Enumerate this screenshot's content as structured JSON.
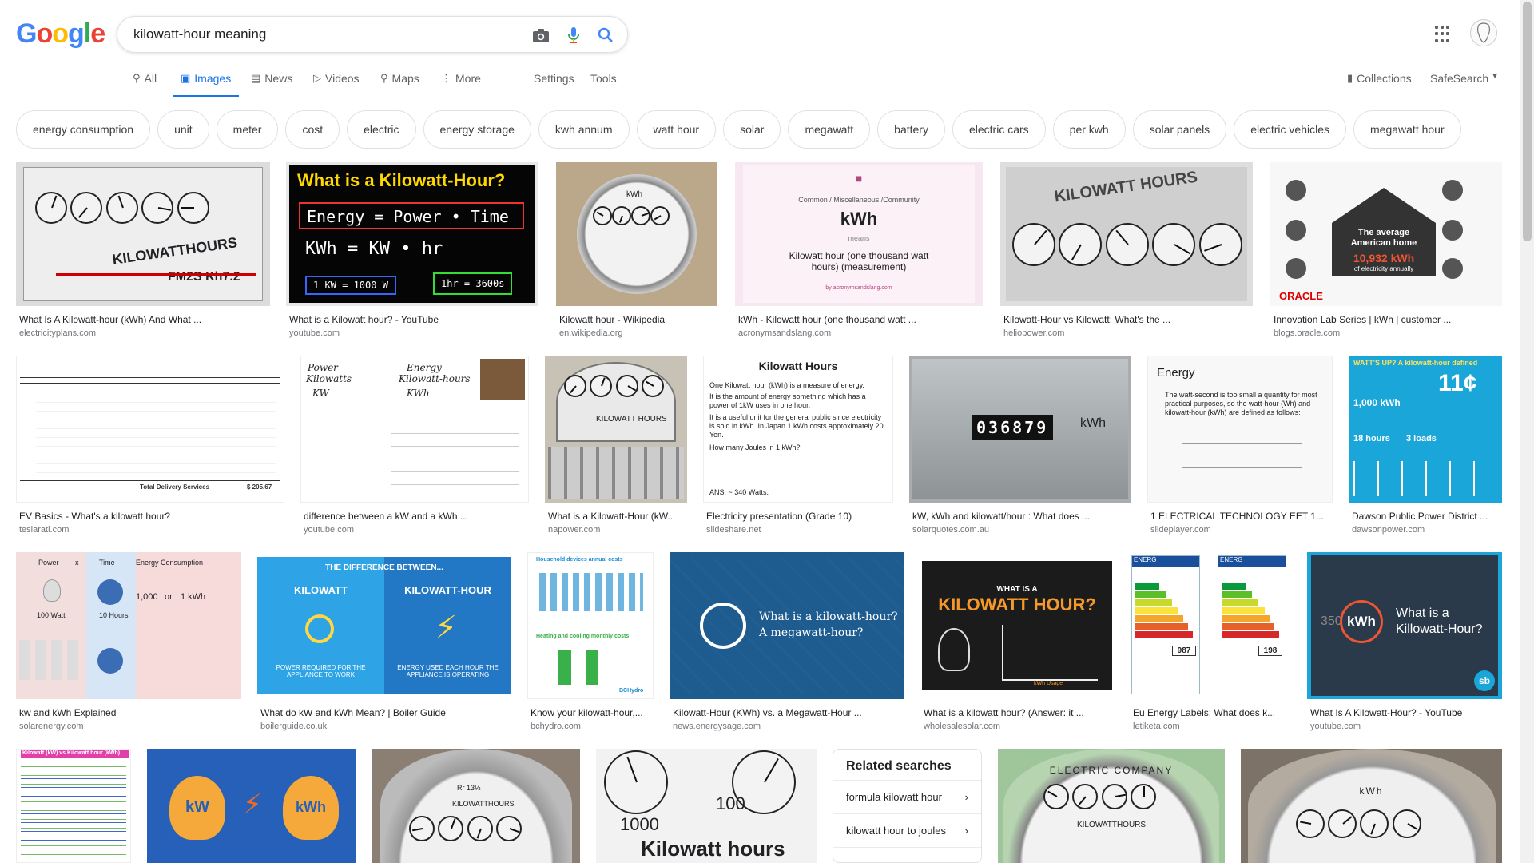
{
  "logo": {
    "letters": [
      "G",
      "o",
      "o",
      "g",
      "l",
      "e"
    ],
    "colors": [
      "#4285f4",
      "#ea4335",
      "#fbbc05",
      "#4285f4",
      "#34a853",
      "#ea4335"
    ]
  },
  "search": {
    "query": "kilowatt-hour meaning"
  },
  "icons": {
    "camera": "camera-icon",
    "mic": "mic-icon",
    "search": "search-icon",
    "apps": "apps-grid-icon"
  },
  "tabs": [
    {
      "label": "All",
      "icon": "search-icon"
    },
    {
      "label": "Images",
      "icon": "image-icon"
    },
    {
      "label": "News",
      "icon": "news-icon"
    },
    {
      "label": "Videos",
      "icon": "video-icon"
    },
    {
      "label": "Maps",
      "icon": "map-icon"
    },
    {
      "label": "More",
      "icon": "more-dots-icon"
    },
    {
      "label": "Settings"
    },
    {
      "label": "Tools"
    }
  ],
  "collections": {
    "label": "Collections"
  },
  "safesearch": {
    "label": "SafeSearch"
  },
  "chips": [
    "energy consumption",
    "unit",
    "meter",
    "cost",
    "electric",
    "energy storage",
    "kwh annum",
    "watt hour",
    "solar",
    "megawatt",
    "battery",
    "electric cars",
    "per kwh",
    "solar panels",
    "electric vehicles",
    "megawatt hour"
  ],
  "results": [
    {
      "title": "What Is A Kilowatt-hour (kWh) And What ...",
      "source": "electricityplans.com"
    },
    {
      "title": "What is a Kilowatt hour? - YouTube",
      "source": "youtube.com"
    },
    {
      "title": "Kilowatt hour - Wikipedia",
      "source": "en.wikipedia.org"
    },
    {
      "title": "kWh - Kilowatt hour (one thousand watt ...",
      "source": "acronymsandslang.com"
    },
    {
      "title": "Kilowatt-Hour vs Kilowatt: What's the ...",
      "source": "heliopower.com"
    },
    {
      "title": "Innovation Lab Series | kWh | customer ...",
      "source": "blogs.oracle.com"
    },
    {
      "title": "EV Basics - What's a kilowatt hour?",
      "source": "teslarati.com"
    },
    {
      "title": "difference between a kW and a kWh ...",
      "source": "youtube.com"
    },
    {
      "title": "What is a Kilowatt-Hour (kW...",
      "source": "napower.com"
    },
    {
      "title": "Electricity presentation (Grade 10)",
      "source": "slideshare.net"
    },
    {
      "title": "kW, kWh and kilowatt/hour : What does ...",
      "source": "solarquotes.com.au"
    },
    {
      "title": "1 ELECTRICAL TECHNOLOGY EET 1...",
      "source": "slideplayer.com"
    },
    {
      "title": "Dawson Public Power District ...",
      "source": "dawsonpower.com"
    },
    {
      "title": "kw and kWh Explained",
      "source": "solarenergy.com"
    },
    {
      "title": "What do kW and kWh Mean? | Boiler Guide",
      "source": "boilerguide.co.uk"
    },
    {
      "title": "Know your kilowatt-hour,...",
      "source": "bchydro.com"
    },
    {
      "title": "Kilowatt-Hour (KWh) vs. a Megawatt-Hour ...",
      "source": "news.energysage.com"
    },
    {
      "title": "What is a kilowatt hour? (Answer: it ...",
      "source": "wholesalesolar.com"
    },
    {
      "title": "Eu Energy Labels: What does k...",
      "source": "letiketa.com"
    },
    {
      "title": "What Is A Kilowatt-Hour? - YouTube",
      "source": "youtube.com"
    }
  ],
  "thumbs": {
    "t1": {
      "brand": "KILOWATTHOURS",
      "model": "FM2S Kh7.2"
    },
    "t2": {
      "heading": "What is a Kilowatt-Hour?",
      "l1": "Energy = Power • Time",
      "l2": "KWh = KW • hr",
      "b1": "1 KW = 1000 W",
      "b2": "1hr = 3600s"
    },
    "t3": {
      "label": "kWh"
    },
    "t4": {
      "crumb": "Common / Miscellaneous /Community",
      "big": "kWh",
      "means": "means",
      "def": "Kilowatt hour (one thousand watt hours) (measurement)",
      "site": "by acronymsandslang.com"
    },
    "t5": {
      "label": "KILOWATT HOURS"
    },
    "t6": {
      "l1": "The average",
      "l2": "American home",
      "amount": "10,932 kWh",
      "l3": "of electricity annually",
      "brand": "ORACLE"
    },
    "t7": {
      "total": "Total Delivery Services",
      "amount": "$ 205.67"
    },
    "t8": {
      "a": "Power",
      "b": "Energy",
      "c": "Kilowatts",
      "d": "Kilowatt-hours",
      "e": "KW",
      "f": "KWh"
    },
    "t9": {
      "label": "KILOWATT HOURS"
    },
    "t10": {
      "heading": "Kilowatt Hours",
      "p1": "One Kilowatt hour (kWh) is a measure of energy.",
      "p2": "It is the amount of energy something which has a power of 1kW uses in one hour.",
      "p3": "It is a useful unit for the general public since electricity is sold in kWh. In Japan 1 kWh costs approximately 20 Yen.",
      "p4": "How many Joules in 1 kWh?",
      "ans": "ANS: ~ 340 Watts."
    },
    "t11": {
      "digits": "036879",
      "unit": "kWh"
    },
    "t12": {
      "heading": "Energy",
      "body": "The watt-second is too small a quantity for most practical purposes, so the watt-hour (Wh) and kilowatt-hour (kWh) are defined as follows:"
    },
    "t13": {
      "title": "WATT'S UP? A kilowatt-hour defined",
      "price": "11¢",
      "k": "1,000 kWh",
      "h": "18 hours",
      "l": "3 loads"
    },
    "t14": {
      "p": "Power",
      "x": "x",
      "t": "Time",
      "e": "Energy Consumption",
      "w1": "100 Watt",
      "h1": "10 Hours",
      "v1": "1,000",
      "or": "or",
      "u": "1 kWh"
    },
    "t15": {
      "head": "THE DIFFERENCE BETWEEN...",
      "a": "KILOWATT",
      "b": "KILOWATT-HOUR",
      "ca": "POWER REQUIRED FOR THE APPLIANCE TO WORK",
      "cb": "ENERGY USED EACH HOUR THE APPLIANCE IS OPERATING"
    },
    "t16": {
      "h1": "Household devices annual costs",
      "h2": "Heating and cooling monthly costs",
      "brand": "BCHydro"
    },
    "t17": {
      "l1": "What is a kilowatt-hour?",
      "l2": "A megawatt-hour?"
    },
    "t18": {
      "small": "WHAT IS A",
      "big": "KILOWATT HOUR?",
      "axis": "kWh Usage"
    },
    "t19": {
      "e": "ENERG",
      "n1": "987",
      "n2": "198"
    },
    "t20": {
      "prefix": "350",
      "unit": "kWh",
      "q1": "What is a",
      "q2": "Killowatt-Hour?",
      "sb": "sb"
    },
    "t21": {
      "title": "Kilowatt (kW) vs Kilowatt hour (kWh)"
    },
    "t22": {
      "a": "kW",
      "b": "kWh"
    },
    "t23": {
      "label": "KILOWATTHOURS",
      "top": "Rr 13⅓"
    },
    "t24": {
      "label": "Kilowatt hours",
      "n": "100",
      "n2": "1000"
    },
    "t25": {
      "label": "ELECTRIC COMPANY",
      "sub": "KILOWATTHOURS"
    },
    "t26": {
      "label": "kWh"
    }
  },
  "related": {
    "heading": "Related searches",
    "items": [
      "formula kilowatt hour",
      "kilowatt hour to joules"
    ]
  }
}
